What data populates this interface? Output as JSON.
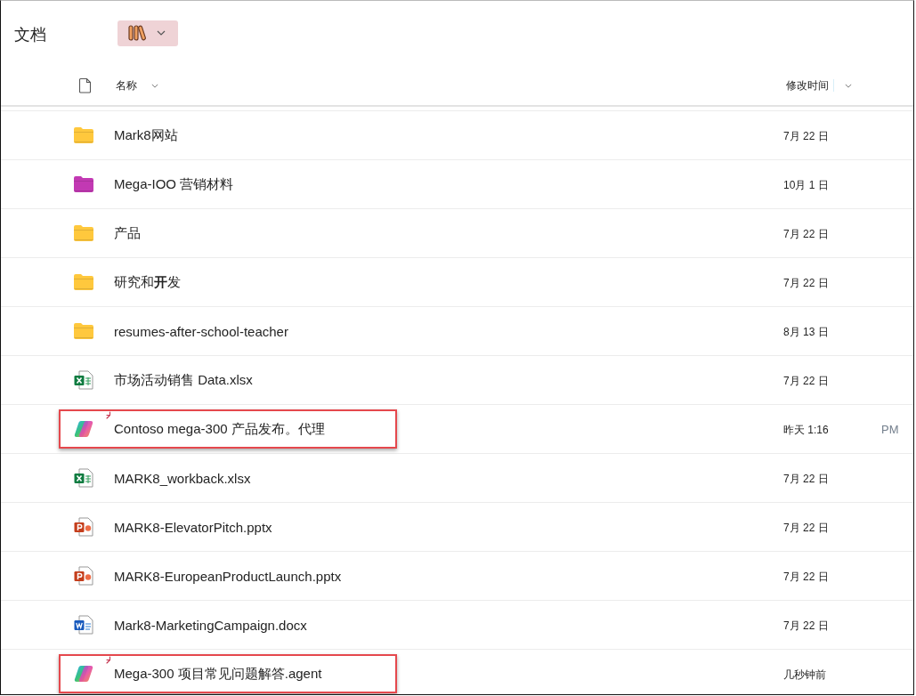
{
  "library": {
    "title": "文档",
    "view_button": {
      "active": true
    }
  },
  "columns": [
    {
      "kind": "name",
      "label": "名称"
    },
    {
      "kind": "modified",
      "label": "修改时间"
    }
  ],
  "rows": [
    {
      "kind": "folder",
      "color": "#ffc83d",
      "name": "Mark8网站",
      "modified": "7月 22 日",
      "new": false,
      "highlighted": false
    },
    {
      "kind": "folder",
      "color": "#c239b3",
      "name": "Mega-IOO 营销材料",
      "modified": "10月 1 日",
      "new": false,
      "highlighted": false
    },
    {
      "kind": "folder",
      "color": "#ffc83d",
      "name": "产品",
      "modified": "7月 22 日",
      "new": false,
      "highlighted": false
    },
    {
      "kind": "folder",
      "color": "#ffc83d",
      "name": "研究和**开**发",
      "modified": "7月 22 日",
      "new": false,
      "highlighted": false
    },
    {
      "kind": "folder",
      "color": "#ffc83d",
      "name": "resumes-after-school-teacher",
      "modified": "8月 13 日",
      "new": false,
      "highlighted": false
    },
    {
      "kind": "excel",
      "name": "市场活动销售 Data.xlsx",
      "modified": "7月 22 日",
      "new": false,
      "highlighted": false
    },
    {
      "kind": "agent",
      "name": "Contoso mega-300 产品发布。代理",
      "modified": "昨天 1:16",
      "modified_suffix": "PM",
      "new": true,
      "highlighted": true
    },
    {
      "kind": "excel",
      "name": "MARK8_workback.xlsx",
      "modified": "7月 22 日",
      "new": false,
      "highlighted": false
    },
    {
      "kind": "powerpoint",
      "name": "MARK8-ElevatorPitch.pptx",
      "modified": "7月 22 日",
      "new": false,
      "highlighted": false
    },
    {
      "kind": "powerpoint",
      "name": "MARK8-EuropeanProductLaunch.pptx",
      "modified": "7月 22 日",
      "new": false,
      "highlighted": false
    },
    {
      "kind": "word",
      "name": "Mark8-MarketingCampaign.docx",
      "modified": "7月 22 日",
      "new": false,
      "highlighted": false
    },
    {
      "kind": "agent",
      "name": "Mega-300 项目常见问题解答.agent",
      "modified": "几秒钟前",
      "new": true,
      "highlighted": true
    }
  ]
}
